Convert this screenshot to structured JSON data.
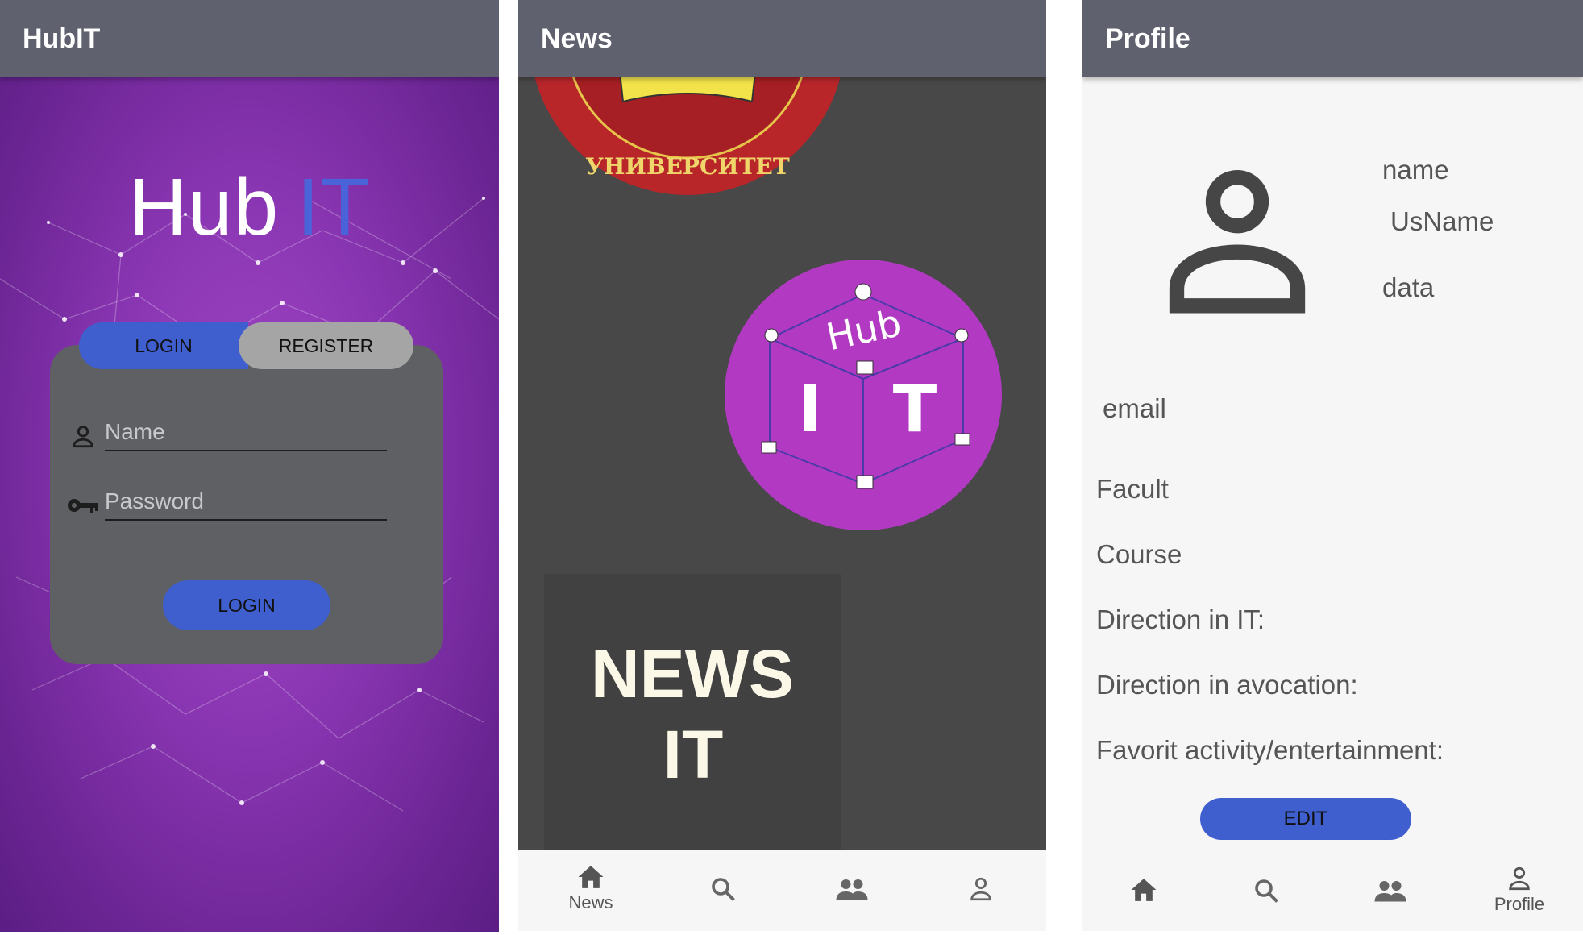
{
  "login_screen": {
    "appbar_title": "HubIT",
    "hero_title_hub": "Hub",
    "hero_title_it": "IT",
    "tabs": {
      "login": "LOGIN",
      "register": "REGISTER"
    },
    "name_placeholder": "Name",
    "password_placeholder": "Password",
    "login_button": "LOGIN",
    "colors": {
      "accent": "#3f5fcf",
      "background": "#8a36b3",
      "card": "#5f6064"
    }
  },
  "news_screen": {
    "appbar_title": "News",
    "university_seal_text": "УНИВЕРСИТЕТ",
    "logo_text_hub": "Hub",
    "logo_text_i": "I",
    "logo_text_t": "T",
    "news_title_line1": "NEWS",
    "news_title_line2": "IT",
    "bottom_nav": [
      {
        "icon": "home-icon",
        "label": "News",
        "active": true
      },
      {
        "icon": "search-icon",
        "label": ""
      },
      {
        "icon": "people-icon",
        "label": ""
      },
      {
        "icon": "person-icon",
        "label": ""
      }
    ]
  },
  "profile_screen": {
    "appbar_title": "Profile",
    "name_label": "name",
    "username_label": "UsName",
    "data_label": "data",
    "fields": {
      "email": "email",
      "facult": "Facult",
      "course": "Course",
      "direction_it": "Direction in IT:",
      "direction_avocation": "Direction in avocation:",
      "favorite_activity": "Favorit activity/entertainment:"
    },
    "edit_button": "EDIT",
    "bottom_nav": [
      {
        "icon": "home-icon",
        "label": ""
      },
      {
        "icon": "search-icon",
        "label": ""
      },
      {
        "icon": "people-icon",
        "label": ""
      },
      {
        "icon": "person-icon",
        "label": "Profile",
        "active": true
      }
    ]
  }
}
